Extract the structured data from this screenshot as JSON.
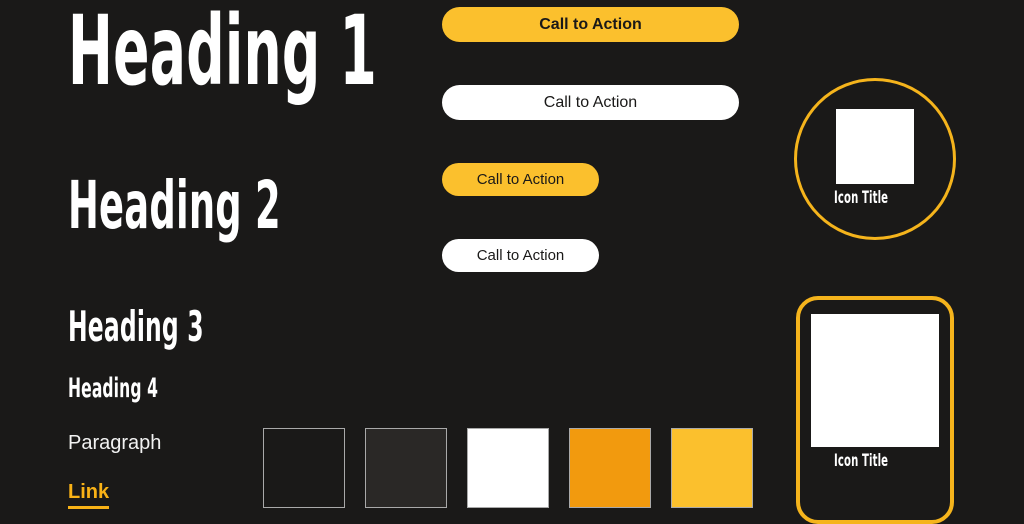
{
  "page": {
    "background_color": "#1a1918"
  },
  "typography": {
    "heading1": "Heading 1",
    "heading2": "Heading 2",
    "heading3": "Heading 3",
    "heading4": "Heading 4",
    "paragraph": "Paragraph",
    "link": "Link",
    "link_color": "#f9b216",
    "text_color": "#ffffff"
  },
  "buttons": [
    {
      "label": "Call to Action",
      "style": "primary-large",
      "fill": "#fbc02d",
      "text_color": "#1a1918"
    },
    {
      "label": "Call to Action",
      "style": "secondary-large",
      "fill": "#ffffff",
      "text_color": "#1a1918"
    },
    {
      "label": "Call to Action",
      "style": "primary-small",
      "fill": "#fbc02d",
      "text_color": "#1a1918"
    },
    {
      "label": "Call to Action",
      "style": "secondary-small",
      "fill": "#ffffff",
      "text_color": "#1a1918"
    }
  ],
  "cards": [
    {
      "shape": "circle",
      "title": "Icon Title",
      "border_color": "#f5b41c",
      "icon_fill": "#ffffff"
    },
    {
      "shape": "rounded-rect",
      "title": "Icon Title",
      "border_color": "#f5b41c",
      "icon_fill": "#ffffff"
    }
  ],
  "swatches": [
    {
      "name": "swatch-1",
      "color": "#1a1918"
    },
    {
      "name": "swatch-2",
      "color": "#2a2826"
    },
    {
      "name": "swatch-3",
      "color": "#ffffff"
    },
    {
      "name": "swatch-4",
      "color": "#f29a0e"
    },
    {
      "name": "swatch-5",
      "color": "#fbc02d"
    }
  ]
}
